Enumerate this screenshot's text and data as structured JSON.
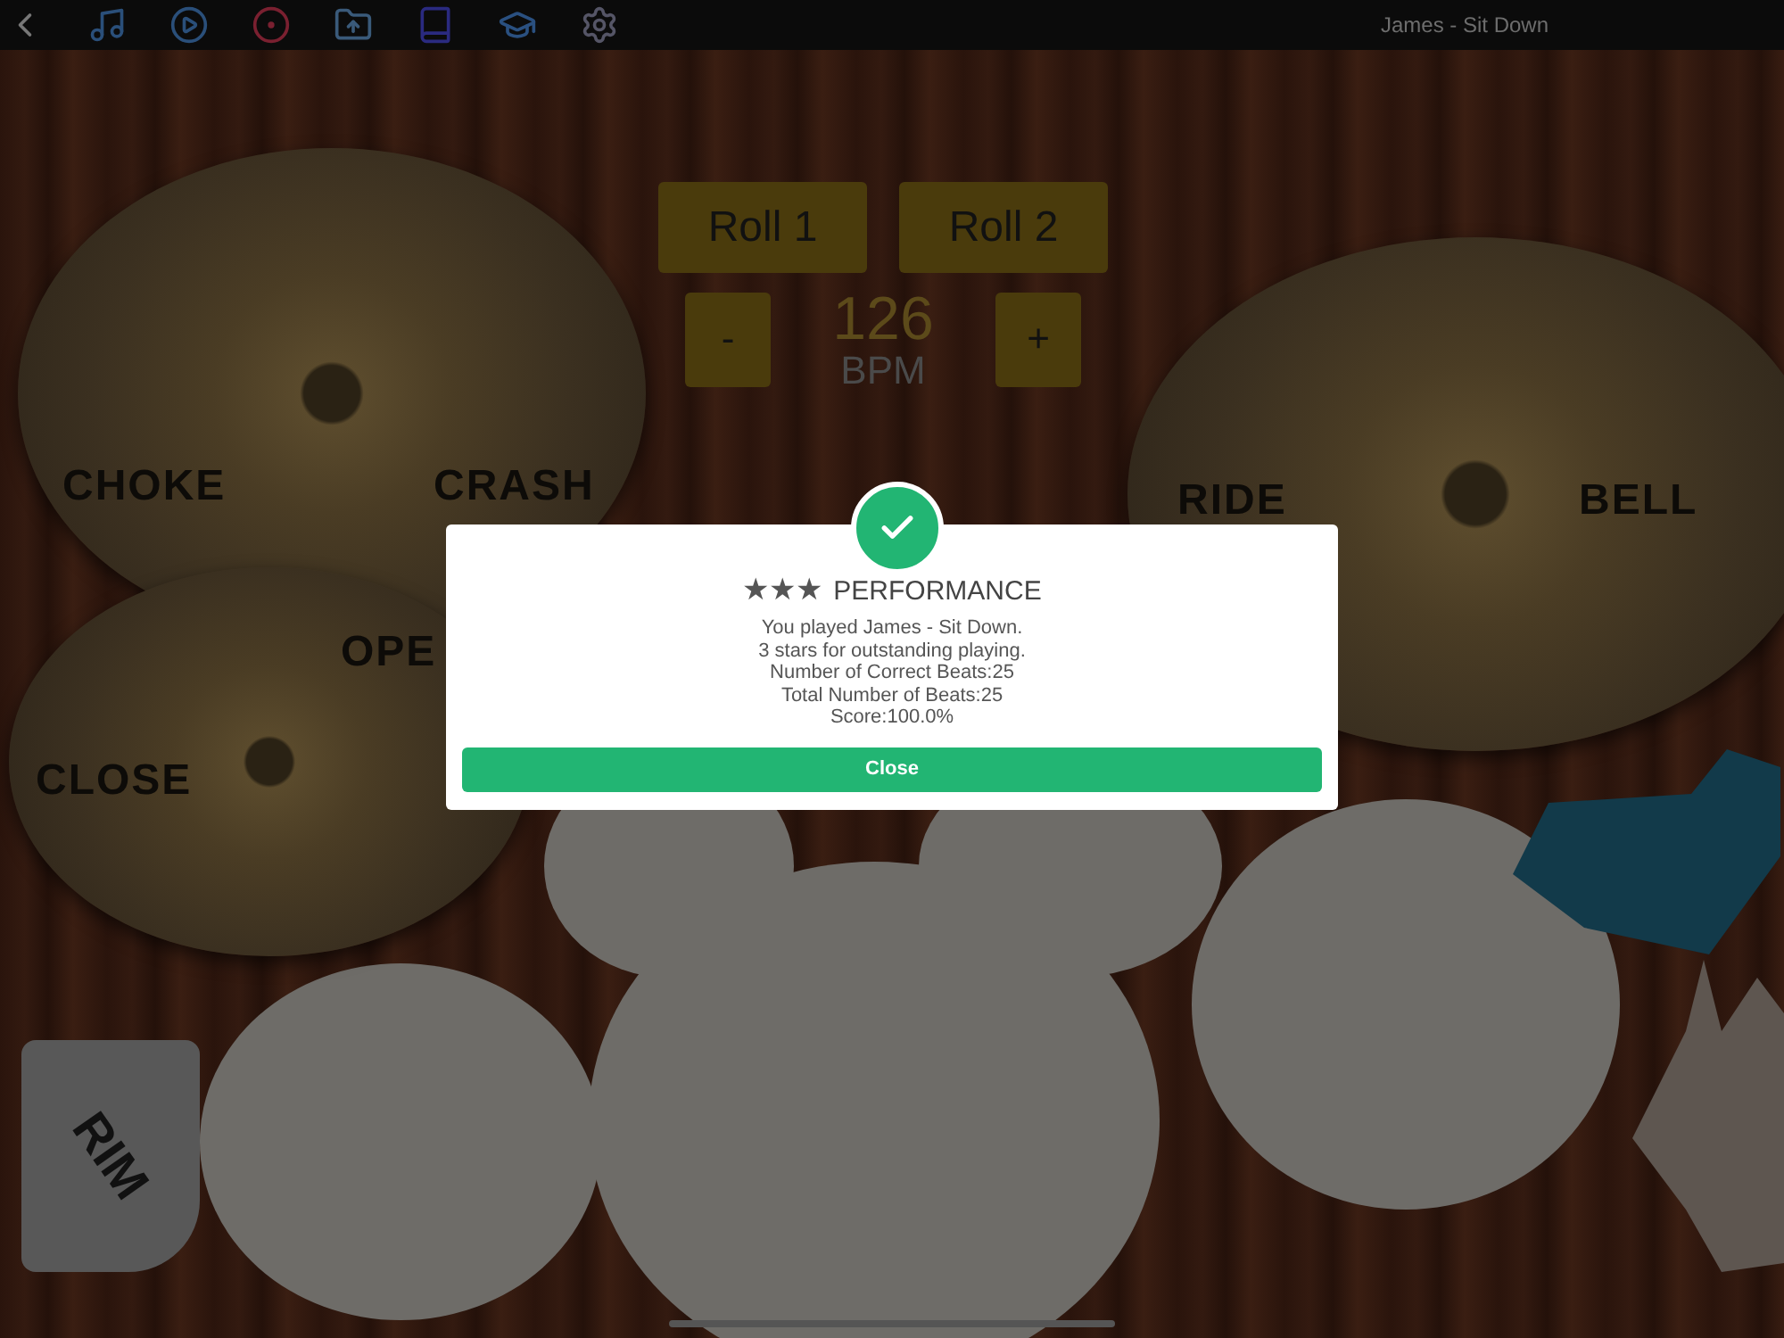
{
  "toolbar": {
    "song_title": "James - Sit Down"
  },
  "cymbals": [
    {
      "kind": "crash",
      "labels": [
        "CHOKE",
        "CRASH"
      ]
    },
    {
      "kind": "ride",
      "labels": [
        "RIDE",
        "BELL"
      ]
    },
    {
      "kind": "hihat",
      "labels": [
        "OPE",
        "CLOSE"
      ]
    }
  ],
  "rim": {
    "label": "RIM"
  },
  "rolls": [
    {
      "label": "Roll 1"
    },
    {
      "label": "Roll 2"
    }
  ],
  "tempo": {
    "minus": "-",
    "value": "126",
    "unit": "BPM",
    "plus": "+"
  },
  "dialog": {
    "stars": 3,
    "title": "PERFORMANCE",
    "lines": [
      "You played James - Sit Down.",
      "3 stars for outstanding playing.",
      "Number of Correct Beats:25",
      "Total Number of Beats:25",
      "Score:100.0%"
    ],
    "button": "Close"
  }
}
